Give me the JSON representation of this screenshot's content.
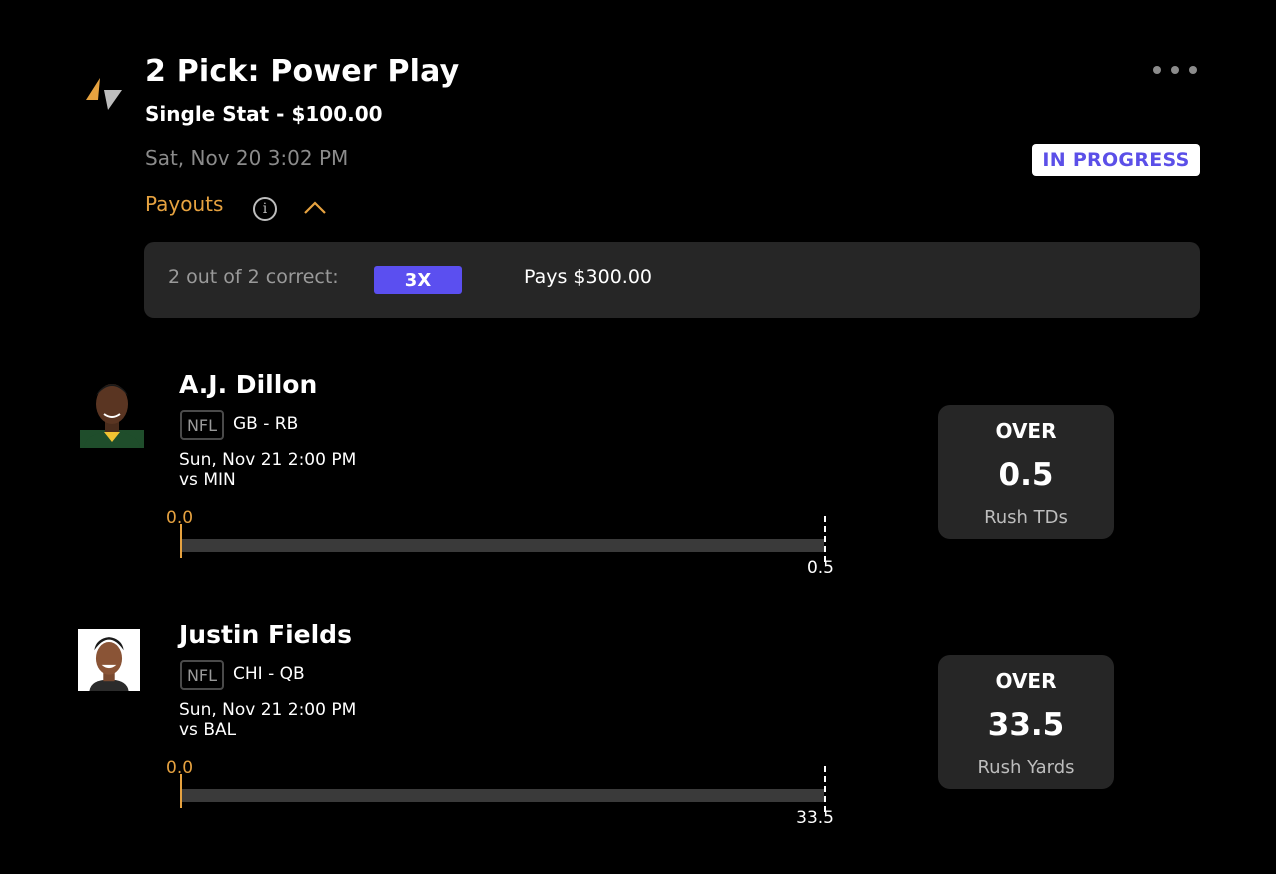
{
  "header": {
    "logo_icon": "lightning-logo-icon",
    "title": "2 Pick: Power Play",
    "subtitle": "Single Stat - $100.00",
    "datetime": "Sat, Nov 20 3:02 PM",
    "status": "IN PROGRESS",
    "more_icon": "ellipsis-icon"
  },
  "payouts": {
    "label": "Payouts",
    "info_icon": "info-icon",
    "toggle_icon": "chevron-up-icon",
    "rows": [
      {
        "condition": "2 out of 2 correct:",
        "multiplier": "3X",
        "pays": "Pays $300.00"
      }
    ]
  },
  "colors": {
    "accent": "#e6a240",
    "multiplier": "#5b4ff0",
    "status_text": "#5b4fe8",
    "card_bg": "#262626"
  },
  "picks": [
    {
      "name": "A.J. Dillon",
      "league": "NFL",
      "team_pos": "GB - RB",
      "game_time": "Sun, Nov 21 2:00 PM",
      "opponent": "vs MIN",
      "current": "0.0",
      "line": "0.5",
      "progress": 0.0,
      "direction": "OVER",
      "stat": "Rush TDs"
    },
    {
      "name": "Justin Fields",
      "league": "NFL",
      "team_pos": "CHI - QB",
      "game_time": "Sun, Nov 21 2:00 PM",
      "opponent": "vs BAL",
      "current": "0.0",
      "line": "33.5",
      "progress": 0.0,
      "direction": "OVER",
      "stat": "Rush Yards"
    }
  ]
}
